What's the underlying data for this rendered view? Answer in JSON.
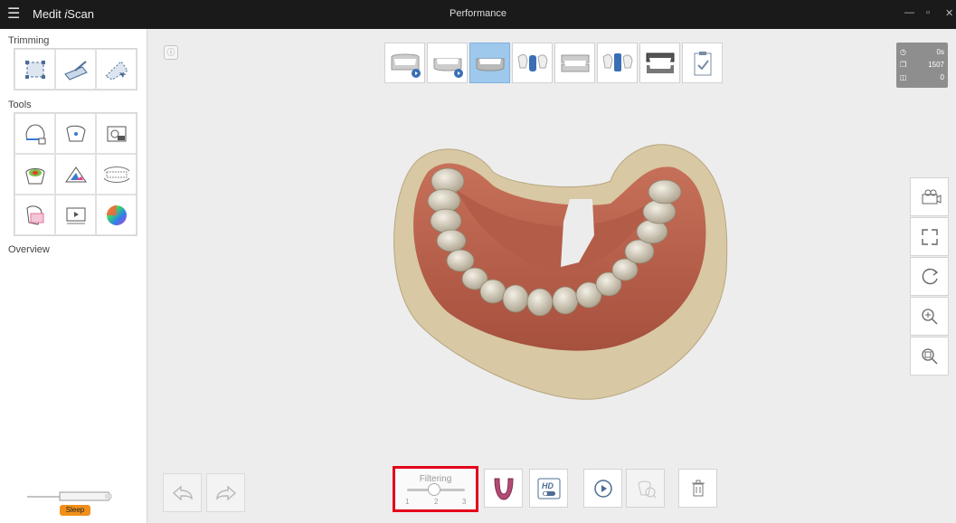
{
  "titlebar": {
    "menu_icon": "hamburger-icon",
    "app_name": "Medit iScan",
    "app_name_prefix": "Medit ",
    "app_name_italic": "i",
    "app_name_suffix": "Scan",
    "center_title": "Performance"
  },
  "sidebar": {
    "sections": {
      "trimming": "Trimming",
      "tools": "Tools",
      "overview": "Overview"
    },
    "trimming_items": [
      "trim-select-icon",
      "trim-brush-icon",
      "trim-lasso-icon"
    ],
    "tools_items": [
      "lock-margin-icon",
      "arch-lock-icon",
      "capture-icon",
      "heatmap-icon",
      "occlusion-icon",
      "bite-align-icon",
      "mark-area-icon",
      "video-icon",
      "color-sphere-icon"
    ],
    "scanner_status": "Sleep"
  },
  "stages": [
    {
      "icon": "maxilla-stage-icon",
      "active": false
    },
    {
      "icon": "mandible-stage-icon",
      "active": false
    },
    {
      "icon": "mandible-raw-stage-icon",
      "active": true
    },
    {
      "icon": "abutment-stage-icon",
      "active": false
    },
    {
      "icon": "occlusion-stage-icon",
      "active": false
    },
    {
      "icon": "scanbody-stage-icon",
      "active": false
    },
    {
      "icon": "bite-stage-icon",
      "active": false
    },
    {
      "icon": "checklist-icon",
      "active": false
    }
  ],
  "stats": {
    "time": "0s",
    "frames": "1507",
    "count": "0"
  },
  "right_tools": [
    "camera-view-icon",
    "fit-view-icon",
    "rotate-icon",
    "zoom-in-icon",
    "zoom-fit-icon"
  ],
  "bottom": {
    "filtering_label": "Filtering",
    "filter_ticks": [
      "1",
      "2",
      "3"
    ],
    "filter_value": 2,
    "hd_label": "HD"
  },
  "colors": {
    "accent": "#9ec8ec",
    "highlight": "#e3051b",
    "sleep": "#f0901a"
  }
}
